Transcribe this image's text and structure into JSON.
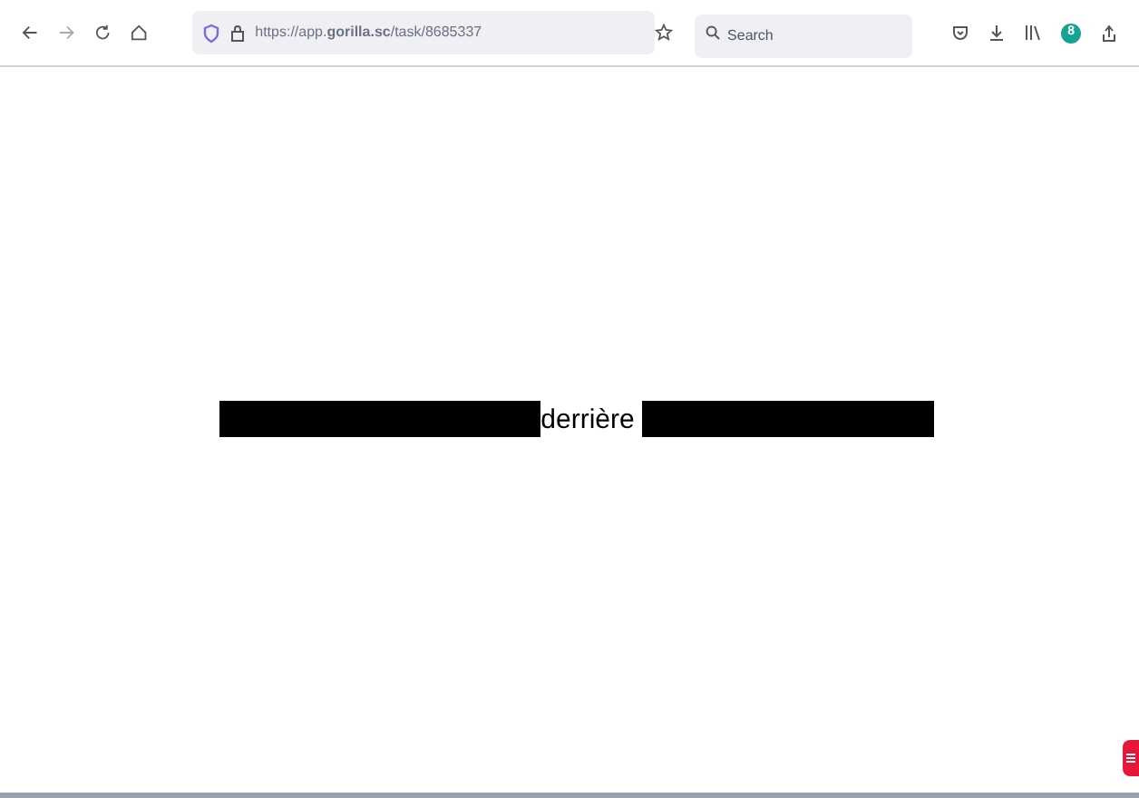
{
  "toolbar": {
    "url": "https://app.**gorilla.sc**/task/8685337",
    "search": {
      "placeholder": "Search"
    },
    "extension_badge": "8"
  },
  "content": {
    "parts": [
      {
        "kind": "redacted"
      },
      {
        "kind": "text",
        "text": "derrière"
      },
      {
        "kind": "redacted"
      }
    ]
  }
}
